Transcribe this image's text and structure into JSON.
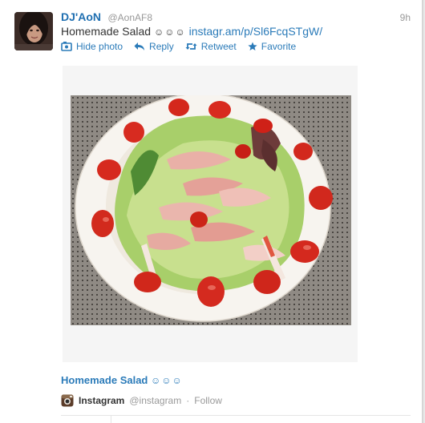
{
  "tweet": {
    "display_name": "DJ'AoN",
    "handle": "@AonAF8",
    "time": "9h",
    "text": "Homemade Salad",
    "emoticons": "☺☺☺",
    "link": "instagr.am/p/Sl6FcqSTgW/"
  },
  "actions": {
    "hide_photo": "Hide photo",
    "reply": "Reply",
    "retweet": "Retweet",
    "favorite": "Favorite"
  },
  "card": {
    "title": "Homemade Salad",
    "emoticons": "☺☺☺",
    "source_name": "Instagram",
    "source_handle": "@instagram",
    "separator": "·",
    "follow": "Follow"
  },
  "colors": {
    "link": "#2b7bb9",
    "name": "#1f6fb1",
    "muted": "#999999"
  }
}
